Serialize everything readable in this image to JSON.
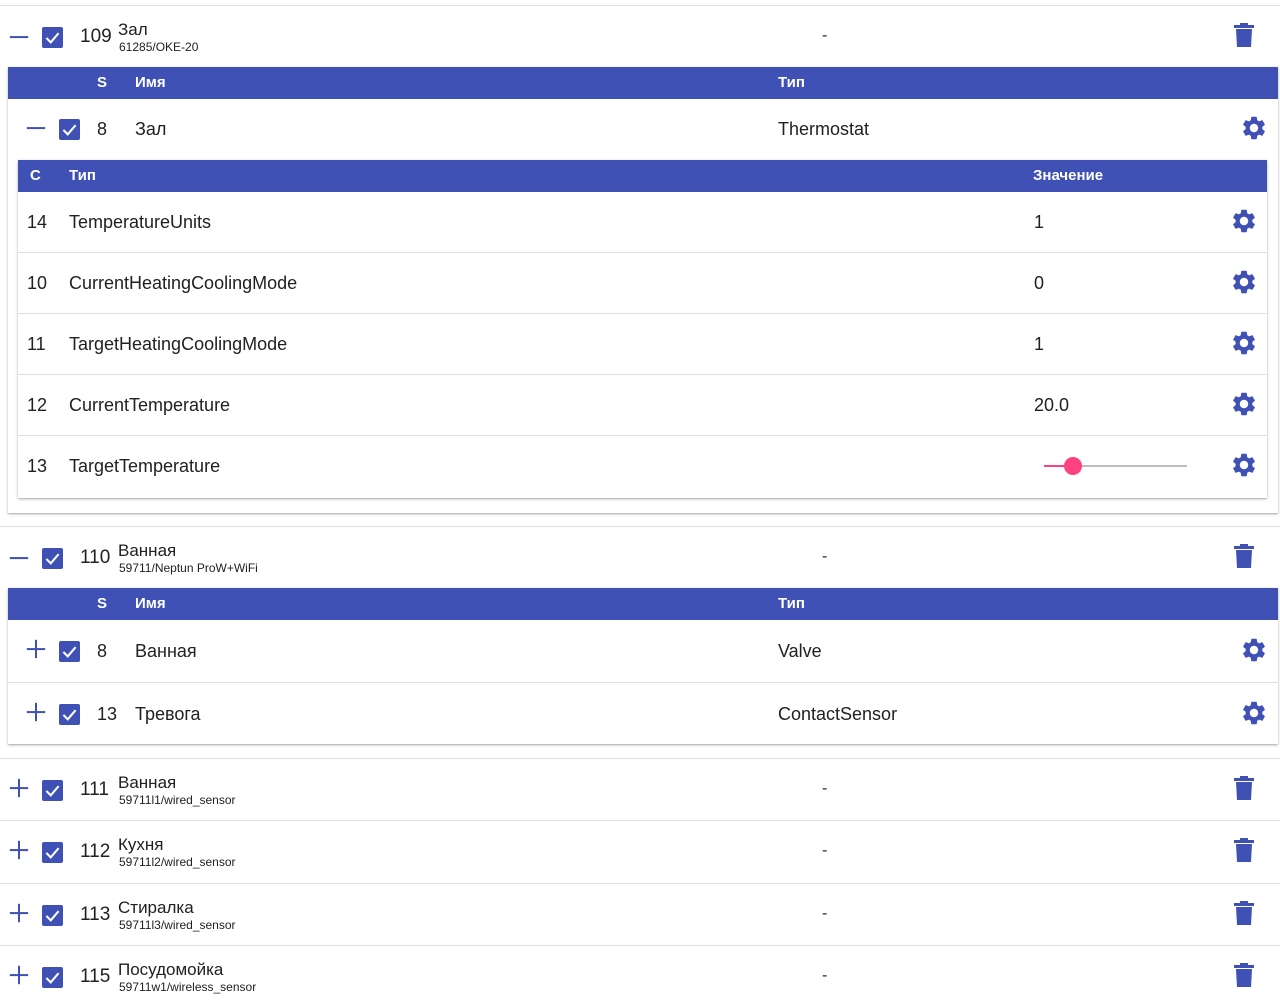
{
  "colors": {
    "primary": "#3f51b5",
    "accent": "#ff4081",
    "divider": "#e0e0e0"
  },
  "icons": {
    "collapse": "minus-icon",
    "expand": "plus-icon",
    "check": "checkbox-checked-icon",
    "delete": "trash-icon",
    "settings": "gear-icon"
  },
  "devices": [
    {
      "id": "109",
      "name": "Зал",
      "model": "61285/OKE-20",
      "value": "-",
      "expanded": true,
      "services_header": {
        "s": "S",
        "name": "Имя",
        "type": "Тип"
      },
      "services": [
        {
          "s": "8",
          "name": "Зал",
          "type": "Thermostat",
          "expanded": true,
          "char_header": {
            "c": "С",
            "type": "Тип",
            "value": "Значение"
          },
          "characteristics": [
            {
              "c": "14",
              "type": "TemperatureUnits",
              "value": "1"
            },
            {
              "c": "10",
              "type": "CurrentHeatingCoolingMode",
              "value": "0"
            },
            {
              "c": "11",
              "type": "TargetHeatingCoolingMode",
              "value": "1"
            },
            {
              "c": "12",
              "type": "CurrentTemperature",
              "value": "20.0"
            },
            {
              "c": "13",
              "type": "TargetTemperature",
              "slider_fraction": 0.2
            }
          ]
        }
      ]
    },
    {
      "id": "110",
      "name": "Ванная",
      "model": "59711/Neptun ProW+WiFi",
      "value": "-",
      "expanded": true,
      "services_header": {
        "s": "S",
        "name": "Имя",
        "type": "Тип"
      },
      "services": [
        {
          "s": "8",
          "name": "Ванная",
          "type": "Valve",
          "expanded": false
        },
        {
          "s": "13",
          "name": "Тревога",
          "type": "ContactSensor",
          "expanded": false
        }
      ]
    },
    {
      "id": "111",
      "name": "Ванная",
      "model": "59711l1/wired_sensor",
      "value": "-",
      "expanded": false
    },
    {
      "id": "112",
      "name": "Кухня",
      "model": "59711l2/wired_sensor",
      "value": "-",
      "expanded": false
    },
    {
      "id": "113",
      "name": "Стиралка",
      "model": "59711l3/wired_sensor",
      "value": "-",
      "expanded": false
    },
    {
      "id": "115",
      "name": "Посудомойка",
      "model": "59711w1/wireless_sensor",
      "value": "-",
      "expanded": false
    }
  ]
}
